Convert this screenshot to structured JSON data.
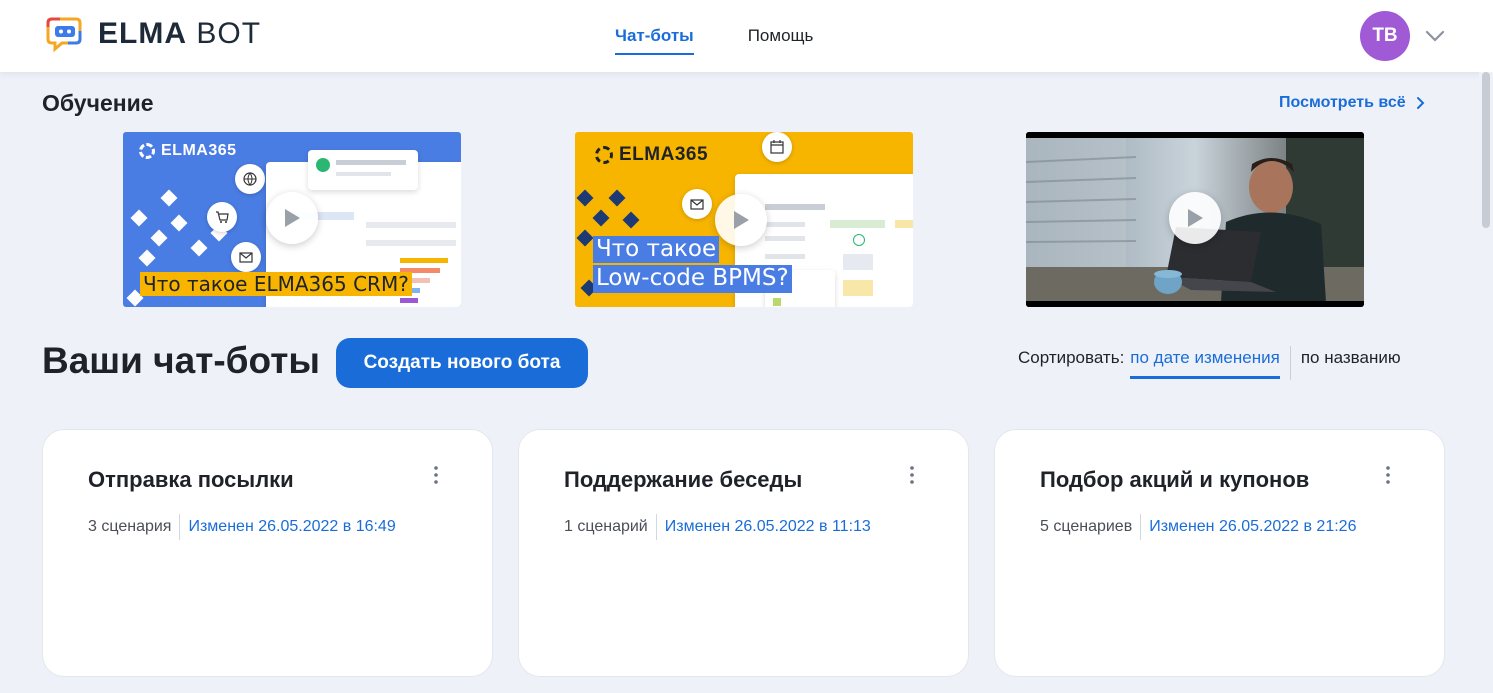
{
  "header": {
    "logo_bold": "ELMA",
    "logo_light": "BOT",
    "nav": [
      {
        "label": "Чат-боты",
        "active": true
      },
      {
        "label": "Помощь",
        "active": false
      }
    ],
    "avatar_initials": "TB",
    "avatar_color": "#a05ad6"
  },
  "learning": {
    "title": "Обучение",
    "see_all": "Посмотреть всё",
    "videos": [
      {
        "brand": "ELMA365",
        "caption": "Что такое ELMA365 CRM?"
      },
      {
        "brand": "ELMA365",
        "caption_line1": "Что такое",
        "caption_line2": "Low-code BPMS?"
      },
      {
        "brand": "",
        "caption": ""
      }
    ]
  },
  "bots": {
    "title": "Ваши чат-боты",
    "create_button": "Создать нового бота",
    "sort_label": "Сортировать:",
    "sort_options": [
      {
        "label": "по дате изменения",
        "active": true
      },
      {
        "label": "по названию",
        "active": false
      }
    ],
    "cards": [
      {
        "title": "Отправка посылки",
        "scenarios": "3 сценария",
        "changed": "Изменен 26.05.2022 в 16:49"
      },
      {
        "title": "Поддержание беседы",
        "scenarios": "1 сценарий",
        "changed": "Изменен 26.05.2022 в 11:13"
      },
      {
        "title": "Подбор акций и купонов",
        "scenarios": "5 сценариев",
        "changed": "Изменен 26.05.2022 в 21:26"
      }
    ]
  },
  "colors": {
    "accent": "#1a6dd8",
    "background": "#eef2f8",
    "video1_bg": "#4a7de3",
    "video2_bg": "#f7b500"
  }
}
